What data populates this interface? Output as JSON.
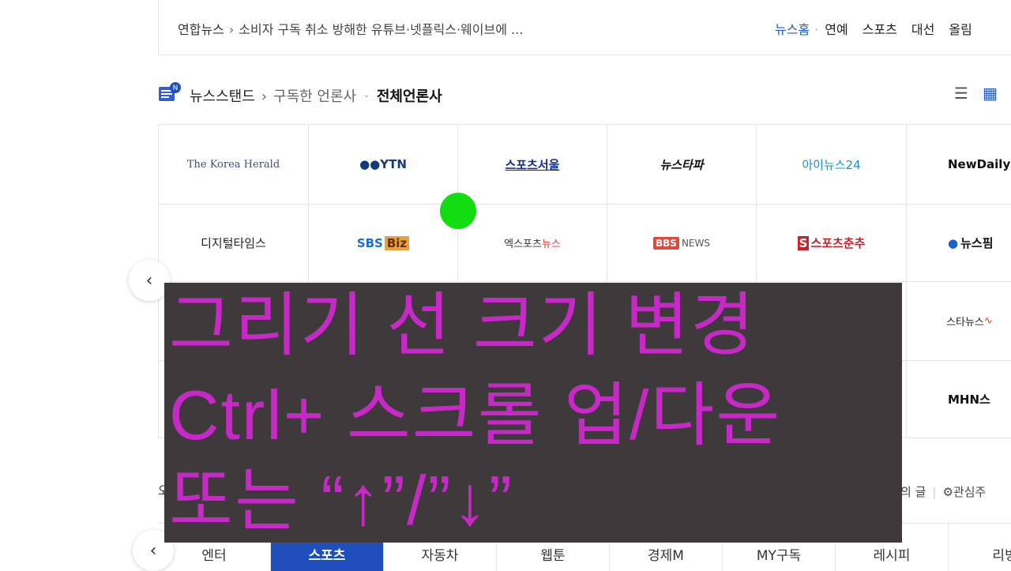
{
  "top_bar": {
    "source": "연합뉴스",
    "breadcrumb_sep": "›",
    "headline": "소비자 구독 취소 방해한 유튜브·넷플릭스·웨이브에 ...",
    "nav": {
      "home": "뉴스홈",
      "dot": "·",
      "items": [
        "연예",
        "스포츠",
        "대선",
        "올림"
      ]
    }
  },
  "newsstand": {
    "logo_badge": "N",
    "title": "뉴스스탠드",
    "sep": "›",
    "subscribed": "구독한 언론사",
    "dot": "·",
    "all": "전체언론사",
    "list_view_icon": "list-icon",
    "grid_view_icon": "grid-icon"
  },
  "press": {
    "r1": [
      "The Korea Herald",
      "●●YTN",
      "스포츠서울",
      "뉴스타파",
      "아이뉴스24",
      "NewDaily"
    ],
    "r2": {
      "digital": "디지털타임스",
      "sbs": "SBS",
      "sbs_biz": "Biz",
      "xsports": "엑스포츠",
      "xsports_news": "뉴스",
      "bbs_box": "BBS",
      "bbs_news": "NEWS",
      "spochun_s": "S",
      "spochun": "스포츠춘추",
      "newspim": "뉴스핌"
    },
    "r3_last": "스타뉴스",
    "r4_last": "MHN스"
  },
  "arrows": {
    "prev": "‹"
  },
  "bottom_row": {
    "left": "오",
    "right_text": "의 글",
    "bar": "|",
    "gear_icon": "⚙",
    "interest": "관심주"
  },
  "tabs": [
    "엔터",
    "스포츠",
    "자동차",
    "웹툰",
    "경제M",
    "MY구독",
    "레시피",
    "리빙"
  ],
  "active_tab_index": 1,
  "overlay": {
    "line1": "그리기 선 크기 변경",
    "line2": "Ctrl+ 스크롤 업/다운",
    "line3": "또는 “↑”/”↓”"
  },
  "colors": {
    "accent": "#1f4fbd",
    "overlay_bg": "#3e3a3b",
    "overlay_text": "#c629c6",
    "cursor": "#11dd11"
  }
}
